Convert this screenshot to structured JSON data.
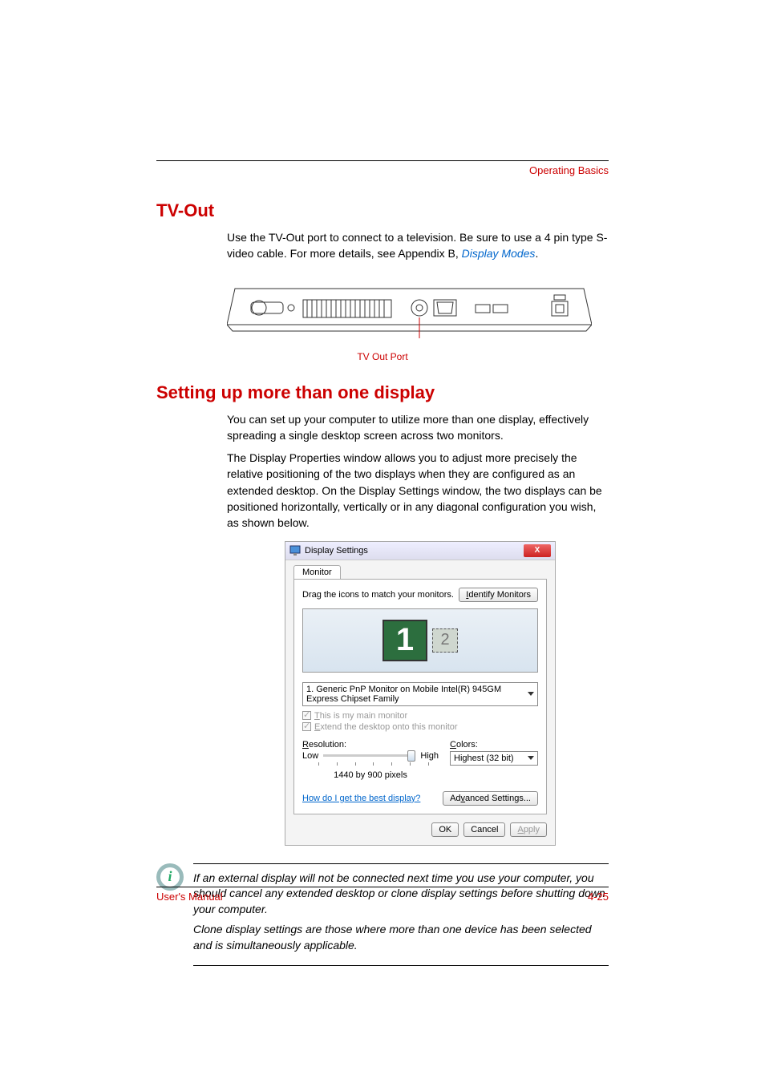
{
  "header": {
    "section": "Operating Basics"
  },
  "tvout": {
    "title": "TV-Out",
    "p1a": "Use the TV-Out port to connect to a television. Be sure to use a 4 pin type S-video cable. For more details, see Appendix B, ",
    "p1link": "Display Modes",
    "p1b": ".",
    "caption": "TV Out Port"
  },
  "setup": {
    "title": "Setting up more than one display",
    "p1": "You can set up your computer to utilize more than one display, effectively spreading a single desktop screen across two monitors.",
    "p2": "The Display Properties window allows you to adjust more precisely the relative positioning of the two displays when they are configured as an extended desktop. On the Display Settings window, the two displays can be positioned horizontally, vertically or in any diagonal configuration you wish, as shown below."
  },
  "dialog": {
    "title": "Display Settings",
    "tab": "Monitor",
    "drag": "Drag the icons to match your monitors.",
    "identify": "Identify Monitors",
    "mon1": "1",
    "mon2": "2",
    "select": "1. Generic PnP Monitor on Mobile Intel(R) 945GM Express Chipset Family",
    "chk1a": "T",
    "chk1b": "his is my main monitor",
    "chk2a": "E",
    "chk2b": "xtend the desktop onto this monitor",
    "res_lbl_a": "R",
    "res_lbl_b": "esolution:",
    "col_lbl_a": "C",
    "col_lbl_b": "olors:",
    "low": "Low",
    "high": "High",
    "res_val": "1440 by 900 pixels",
    "colors_val": "Highest (32 bit)",
    "helplink": "How do I get the best display?",
    "adv": "Advanced Settings...",
    "ok": "OK",
    "cancel": "Cancel",
    "apply_a": "A",
    "apply_b": "pply"
  },
  "note": {
    "p1": "If an external display will not be connected next time you use your computer, you should cancel any extended desktop or clone display settings before shutting down your computer.",
    "p2": "Clone display settings are those where more than one device has been selected and is simultaneously applicable."
  },
  "footer": {
    "left": "User's Manual",
    "right": "4-25"
  }
}
